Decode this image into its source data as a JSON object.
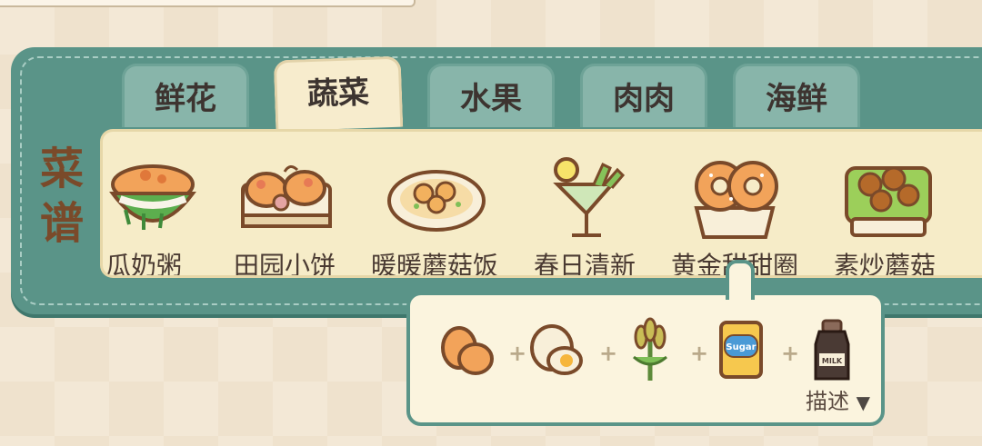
{
  "panel": {
    "title_chars": [
      "菜",
      "谱"
    ]
  },
  "tabs": [
    {
      "label": "鲜花",
      "active": false
    },
    {
      "label": "蔬菜",
      "active": true
    },
    {
      "label": "水果",
      "active": false
    },
    {
      "label": "肉肉",
      "active": false
    },
    {
      "label": "海鲜",
      "active": false
    }
  ],
  "recipes": [
    {
      "label": "瓜奶粥",
      "icon": "porridge-bowl-icon"
    },
    {
      "label": "田园小饼",
      "icon": "pancake-tray-icon"
    },
    {
      "label": "暖暖蘑菇饭",
      "icon": "mushroom-rice-plate-icon"
    },
    {
      "label": "春日清新",
      "icon": "cocktail-glass-icon"
    },
    {
      "label": "黄金甜甜圈",
      "icon": "donut-box-icon"
    },
    {
      "label": "素炒蘑菇",
      "icon": "stir-fried-mushroom-icon"
    }
  ],
  "tooltip": {
    "ingredients": [
      {
        "name": "potato-icon"
      },
      {
        "name": "egg-icon"
      },
      {
        "name": "wheat-icon"
      },
      {
        "name": "sugar-bag-icon",
        "text": "Sugar"
      },
      {
        "name": "milk-bottle-icon",
        "text": "MILK"
      }
    ],
    "plus": "+",
    "describe_label": "描述",
    "describe_arrow": "▼"
  }
}
